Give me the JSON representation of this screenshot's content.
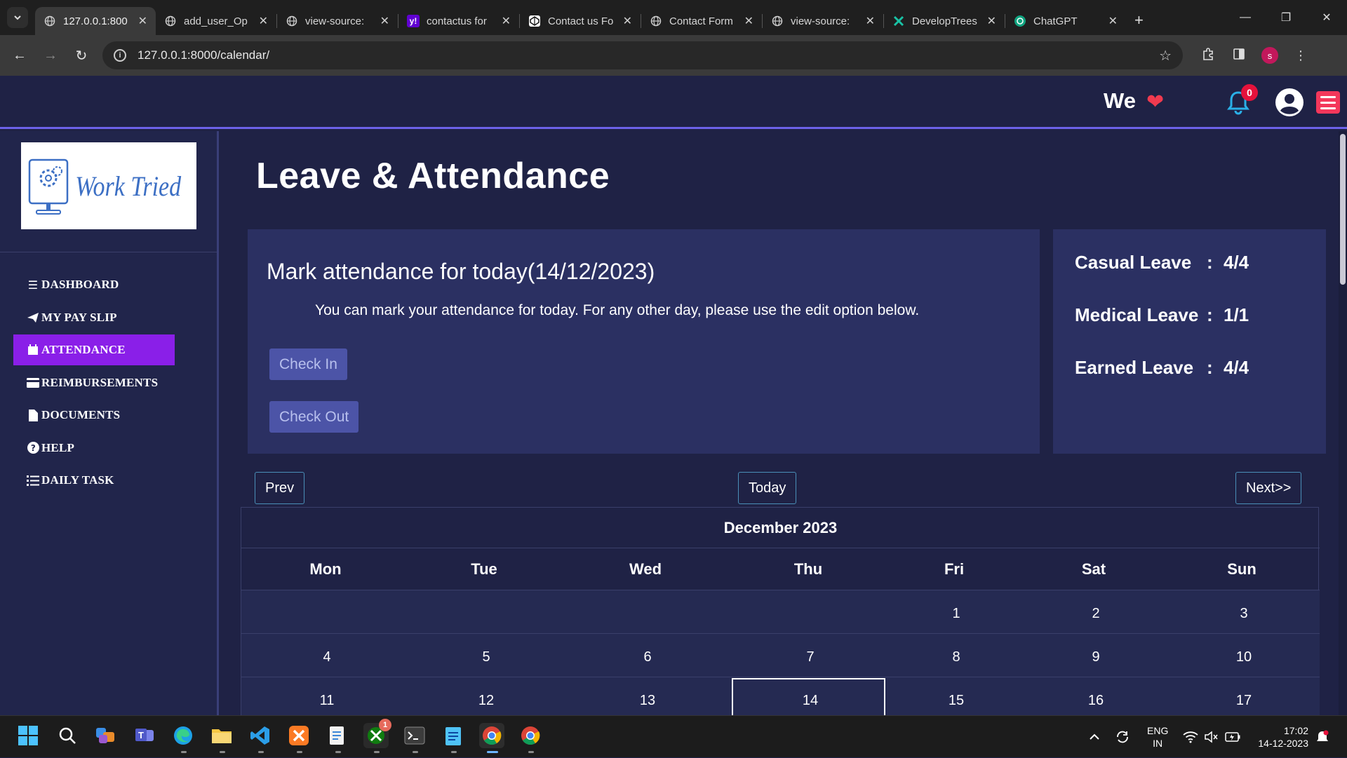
{
  "browser": {
    "tabs": [
      {
        "title": "127.0.0.1:800",
        "active": true
      },
      {
        "title": "add_user_Op"
      },
      {
        "title": "view-source:"
      },
      {
        "title": "contactus for"
      },
      {
        "title": "Contact us Fo"
      },
      {
        "title": "Contact Form"
      },
      {
        "title": "view-source:"
      },
      {
        "title": "DevelopTrees"
      },
      {
        "title": "ChatGPT"
      }
    ],
    "url": "127.0.0.1:8000/calendar/",
    "profile_initial": "s"
  },
  "header": {
    "we_text": "We",
    "notification_count": "0"
  },
  "sidebar": {
    "logo_text": "Work Tried",
    "items": [
      {
        "label": "DASHBOARD",
        "icon": "bars-icon"
      },
      {
        "label": "MY PAY SLIP",
        "icon": "paper-plane-icon"
      },
      {
        "label": "ATTENDANCE",
        "icon": "calendar-icon",
        "active": true
      },
      {
        "label": "REIMBURSEMENTS",
        "icon": "credit-card-icon"
      },
      {
        "label": "DOCUMENTS",
        "icon": "file-icon"
      },
      {
        "label": "HELP",
        "icon": "question-circle-icon"
      },
      {
        "label": "DAILY TASK",
        "icon": "list-icon"
      }
    ]
  },
  "main": {
    "title": "Leave & Attendance",
    "attendance": {
      "heading": "Mark attendance for today(14/12/2023)",
      "description": "You can mark your attendance for today. For any other day, please use the edit option below.",
      "check_in": "Check In",
      "check_out": "Check Out"
    },
    "leaves": [
      {
        "name": "Casual Leave",
        "value": "4/4"
      },
      {
        "name": "Medical Leave",
        "value": "1/1"
      },
      {
        "name": "Earned Leave",
        "value": "4/4"
      }
    ],
    "calendar": {
      "prev": "Prev",
      "today": "Today",
      "next": "Next>>",
      "month": "December 2023",
      "weekdays": [
        "Mon",
        "Tue",
        "Wed",
        "Thu",
        "Fri",
        "Sat",
        "Sun"
      ],
      "weeks": [
        [
          "",
          "",
          "",
          "",
          "1",
          "2",
          "3"
        ],
        [
          "4",
          "5",
          "6",
          "7",
          "8",
          "9",
          "10"
        ],
        [
          "11",
          "12",
          "13",
          "14",
          "15",
          "16",
          "17"
        ]
      ],
      "selected_day": "14"
    }
  },
  "taskbar": {
    "lang_top": "ENG",
    "lang_bottom": "IN",
    "time": "17:02",
    "date": "14-12-2023",
    "badges": {
      "xbox": "1"
    }
  },
  "colors": {
    "page_bg": "#1f2245",
    "card_bg": "#2b3062",
    "active_nav": "#8a1fe8",
    "accent_border": "#6d62e8",
    "menu_button": "#f4375b",
    "check_button": "#4c54a7"
  }
}
